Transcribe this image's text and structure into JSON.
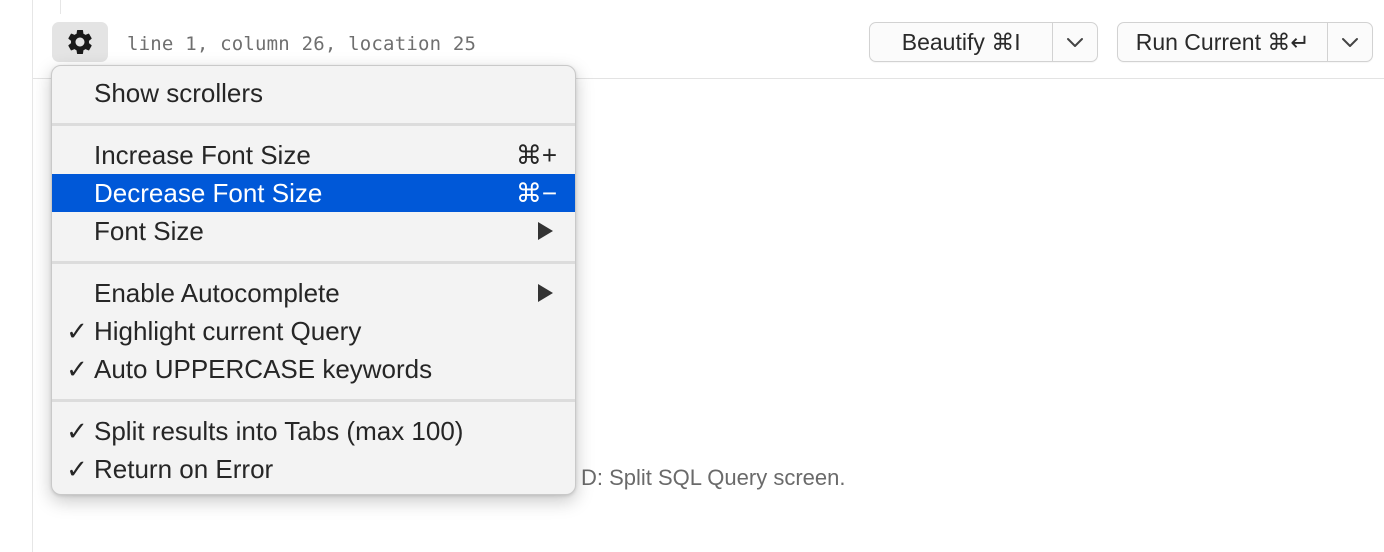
{
  "toolbar": {
    "settings_icon": "gear-icon",
    "status": "line 1, column 26, location 25",
    "beautify_label": "Beautify ⌘I",
    "run_label": "Run Current ⌘↵",
    "dropdown_icon": "chevron-down-icon"
  },
  "editor": {
    "hint_text": "+ D: Split SQL Query screen."
  },
  "menu": {
    "highlight_color": "#0058d8",
    "items": [
      {
        "label": "Show scrollers",
        "checked": false,
        "shortcut": ""
      },
      {
        "label": "Increase Font Size",
        "checked": false,
        "shortcut": "⌘+"
      },
      {
        "label": "Decrease Font Size",
        "checked": false,
        "shortcut": "⌘−",
        "highlighted": true
      },
      {
        "label": "Font Size",
        "checked": false,
        "submenu": true
      },
      {
        "label": "Enable Autocomplete",
        "checked": false,
        "submenu": true
      },
      {
        "label": "Highlight current Query",
        "checked": true,
        "check_mark": "✓"
      },
      {
        "label": "Auto UPPERCASE keywords",
        "checked": true,
        "check_mark": "✓"
      },
      {
        "label": "Split results into Tabs (max 100)",
        "checked": true,
        "check_mark": "✓"
      },
      {
        "label": "Return on Error",
        "checked": true,
        "check_mark": "✓"
      }
    ]
  }
}
